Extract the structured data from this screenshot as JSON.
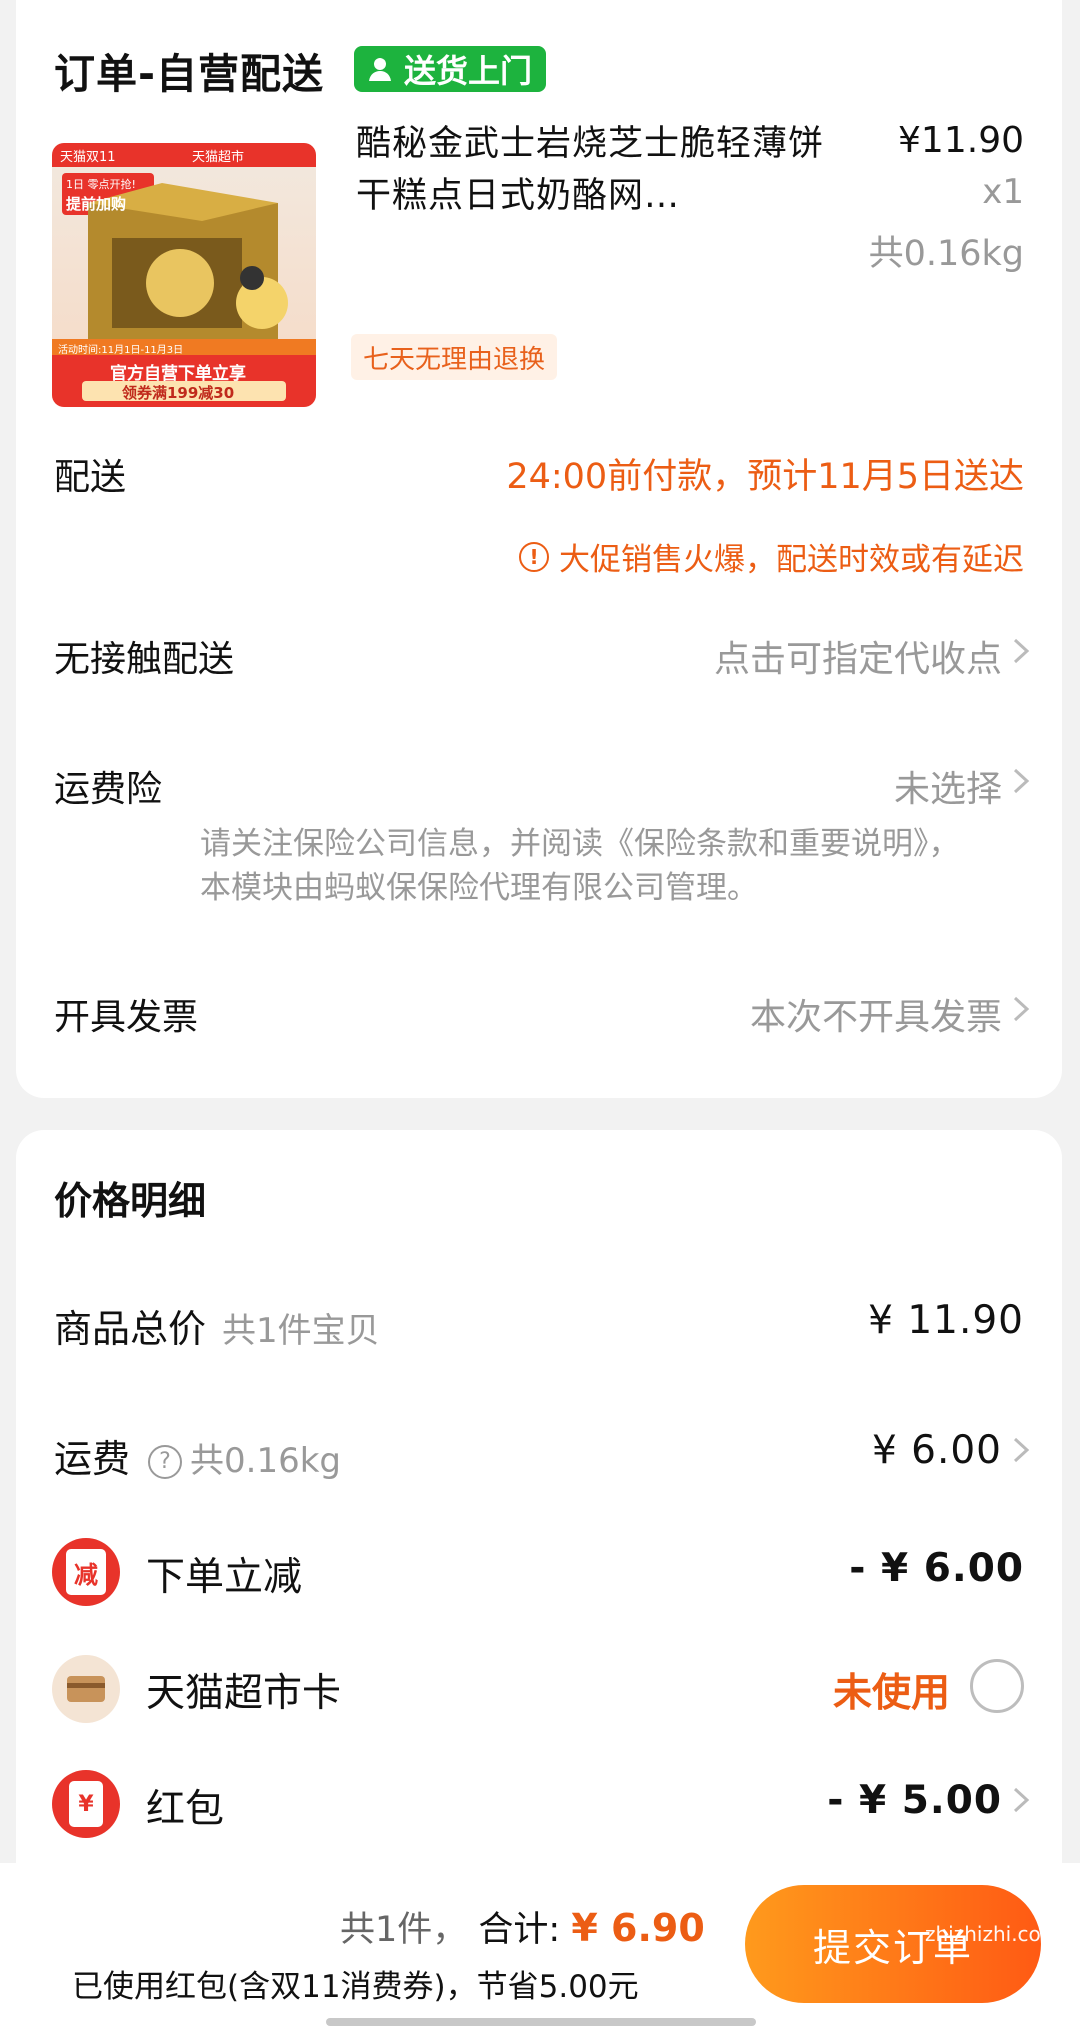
{
  "order": {
    "title": "订单-自营配送",
    "badge": "送货上门"
  },
  "product": {
    "title": "酷秘金武士岩烧芝士脆轻薄饼干糕点日式奶酪网…",
    "price": "¥11.90",
    "quantity": "x1",
    "weight": "共0.16kg",
    "tag": "七天无理由退换",
    "image_texts": {
      "top_left": "天猫双11",
      "top_right": "天猫超市",
      "banner1": "1日 零点开抢!",
      "banner2": "提前加购",
      "activity": "活动时间:11月1日-11月3日",
      "line1": "官方自营下单立享",
      "line2": "领券满199减30"
    }
  },
  "delivery": {
    "label": "配送",
    "value": "24:00前付款，预计11月5日送达",
    "note": "大促销售火爆，配送时效或有延迟"
  },
  "contactless": {
    "label": "无接触配送",
    "value": "点击可指定代收点"
  },
  "insurance": {
    "label": "运费险",
    "value": "未选择",
    "desc": "请关注保险公司信息，并阅读《保险条款和重要说明》，本模块由蚂蚁保保险代理有限公司管理。"
  },
  "invoice": {
    "label": "开具发票",
    "value": "本次不开具发票"
  },
  "price_detail": {
    "title": "价格明细",
    "goods_label": "商品总价",
    "goods_sub": "共1件宝贝",
    "goods_value": "¥ 11.90",
    "shipping_label": "运费",
    "shipping_sub": "共0.16kg",
    "shipping_value": "¥ 6.00",
    "instant_label": "下单立减",
    "instant_icon_text": "减",
    "instant_value": "- ¥ 6.00",
    "card_label": "天猫超市卡",
    "card_value": "未使用",
    "redpack_label": "红包",
    "redpack_icon_text": "¥",
    "redpack_value": "- ¥ 5.00"
  },
  "bottom": {
    "count": "共1件，",
    "total_label": "合计:",
    "total_amount": "¥ 6.90",
    "saving_note": "已使用红包(含双11消费券)，节省5.00元",
    "submit": "提交订单",
    "watermark": "zhizhizhi.com"
  },
  "colors": {
    "accent": "#ec5d14",
    "badge_green": "#1db33e",
    "button_gradient_start": "#ff9a1c",
    "button_gradient_end": "#ff5a14"
  }
}
